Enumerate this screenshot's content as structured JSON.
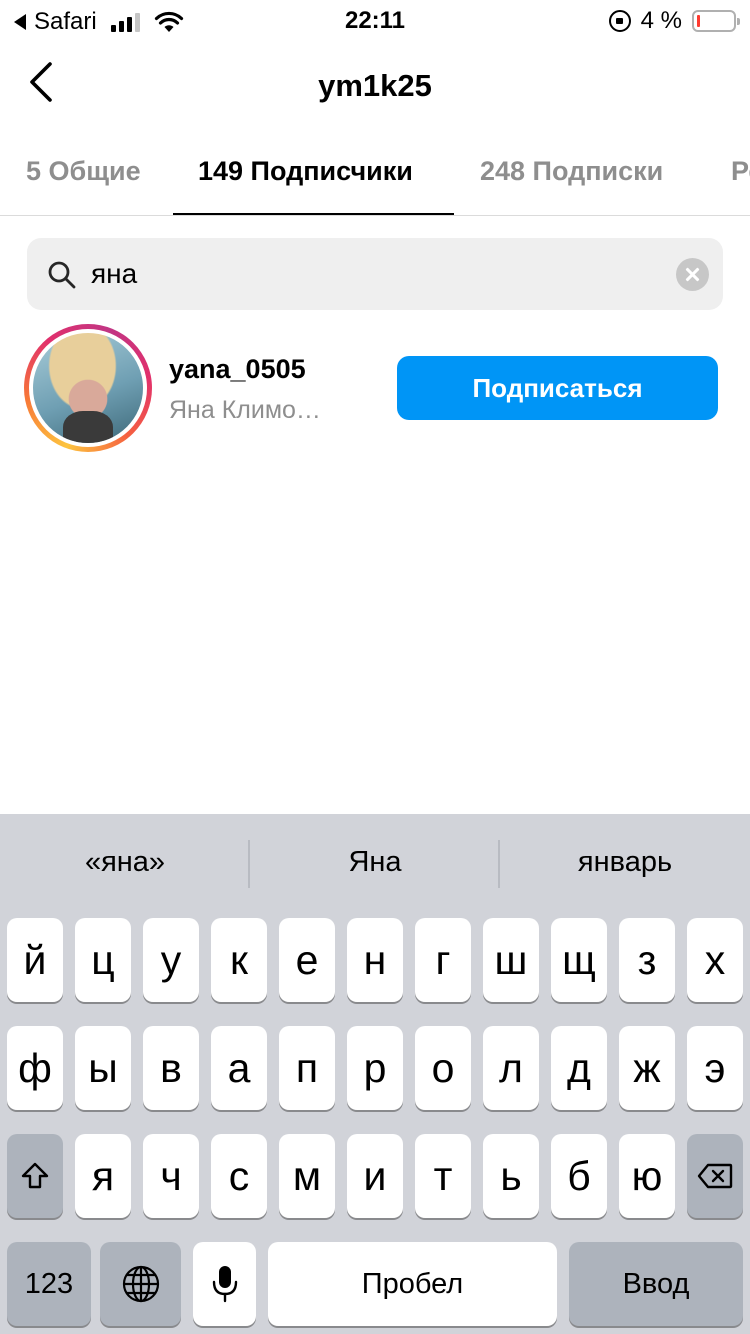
{
  "status_bar": {
    "back_app": "Safari",
    "time": "22:11",
    "battery_percent": "4 %",
    "battery_level": 0.04
  },
  "nav": {
    "title": "ym1k25",
    "back_icon": "chevron-left-icon"
  },
  "tabs": [
    {
      "label": "5 Общие",
      "active": false
    },
    {
      "label": "149 Подписчики",
      "active": true
    },
    {
      "label": "248 Подписки",
      "active": false
    },
    {
      "label": "Ре",
      "active": false
    }
  ],
  "search": {
    "value": "яна",
    "icon": "search-icon",
    "clear_icon": "clear-icon"
  },
  "results": [
    {
      "username": "yana_0505",
      "full_name": "Яна Климо…",
      "button_label": "Подписаться",
      "has_story_ring": true
    }
  ],
  "keyboard": {
    "suggestions": [
      "«яна»",
      "Яна",
      "январь"
    ],
    "row1": [
      "й",
      "ц",
      "у",
      "к",
      "е",
      "н",
      "г",
      "ш",
      "щ",
      "з",
      "х"
    ],
    "row2": [
      "ф",
      "ы",
      "в",
      "а",
      "п",
      "р",
      "о",
      "л",
      "д",
      "ж",
      "э"
    ],
    "row3": [
      "я",
      "ч",
      "с",
      "м",
      "и",
      "т",
      "ь",
      "б",
      "ю"
    ],
    "shift_icon": "shift-icon",
    "delete_icon": "backspace-icon",
    "numbers_label": "123",
    "globe_icon": "globe-icon",
    "mic_icon": "microphone-icon",
    "space_label": "Пробел",
    "return_label": "Ввод"
  },
  "colors": {
    "accent": "#0095f6",
    "keyboard_bg": "#d1d3d9",
    "battery_low": "#ff3b30"
  }
}
